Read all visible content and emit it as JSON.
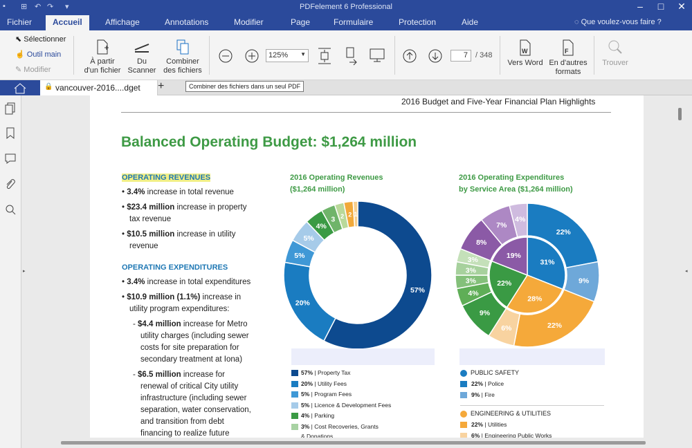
{
  "app": {
    "title": "PDFelement 6 Professional"
  },
  "menu": {
    "items": [
      "Fichier",
      "Accueil",
      "Affichage",
      "Annotations",
      "Modifier",
      "Page",
      "Formulaire",
      "Protection",
      "Aide"
    ],
    "search": "Que voulez-vous faire ?"
  },
  "ribbon": {
    "select": "Sélectionner",
    "hand": "Outil main",
    "edit": "Modifier",
    "from_file": [
      "À partir",
      "d'un fichier"
    ],
    "scanner": [
      "Du",
      "Scanner"
    ],
    "combine": [
      "Combiner",
      "des fichiers"
    ],
    "zoom": "125%",
    "page_current": "7",
    "page_total": "/ 348",
    "to_word": "Vers Word",
    "other_formats": [
      "En d'autres",
      "formats"
    ],
    "find": "Trouver"
  },
  "tabs": {
    "doc": "vancouver-2016....dget",
    "tooltip": "Combiner des fichiers dans un seul PDF"
  },
  "doc": {
    "header": "2016 Budget and Five-Year Financial Plan Highlights",
    "heading": "Balanced Operating Budget: $1,264 million",
    "rev_title": "OPERATING REVENUES",
    "rev_bullets": [
      [
        "3.4%",
        " increase in total revenue"
      ],
      [
        "$23.4 million",
        " increase in property"
      ],
      [
        "",
        "tax revenue"
      ],
      [
        "$10.5 million",
        " increase in utility"
      ],
      [
        "",
        "revenue"
      ]
    ],
    "exp_title": "OPERATING EXPENDITURES",
    "exp_lines": [
      [
        "•",
        "3.4%",
        " increase in total expenditures"
      ],
      [
        "•",
        "$10.9 million (1.1%)",
        " increase in"
      ],
      [
        "",
        "",
        "utility program expenditures:"
      ],
      [
        "-",
        "$4.4 million",
        " increase for Metro"
      ],
      [
        "",
        "",
        "utility charges (including sewer"
      ],
      [
        "",
        "",
        "costs for site preparation for"
      ],
      [
        "",
        "",
        "secondary treatment at Iona)"
      ],
      [
        "-",
        "$6.5 million",
        " increase for"
      ],
      [
        "",
        "",
        "renewal of critical City utility"
      ],
      [
        "",
        "",
        "infrastructure (including sewer"
      ],
      [
        "",
        "",
        "separation, water conservation,"
      ],
      [
        "",
        "",
        "and transition from debt"
      ],
      [
        "",
        "",
        "financing to realize future"
      ]
    ]
  },
  "chart_data": [
    {
      "type": "pie",
      "title": [
        "2016 Operating Revenues",
        "($1,264 million)"
      ],
      "slices": [
        {
          "label": "Property Tax",
          "value": 57,
          "color": "#0d4a8f"
        },
        {
          "label": "Utility Fees",
          "value": 20,
          "color": "#1a7cc1"
        },
        {
          "label": "Program Fees",
          "value": 5,
          "color": "#3f98d6"
        },
        {
          "label": "Licence & Development Fees",
          "value": 5,
          "color": "#a6cbe9"
        },
        {
          "label": "Parking",
          "value": 4,
          "color": "#3a9a44"
        },
        {
          "label": "Cost Recoveries, Grants & Donations",
          "value": 3,
          "color": "#6fb46a"
        },
        {
          "label": "",
          "value": 2,
          "color": "#b9d99a"
        },
        {
          "label": "",
          "value": 2,
          "color": "#f1a93a"
        },
        {
          "label": "",
          "value": 1,
          "color": "#f6cf8f"
        }
      ],
      "slice_labels": [
        "57%",
        "20%",
        "5%",
        "5%",
        "4%",
        "3",
        "2",
        "2",
        "1"
      ],
      "legend": [
        [
          "57%",
          "Property Tax",
          "#0d4a8f"
        ],
        [
          "20%",
          "Utility Fees",
          "#1a7cc1"
        ],
        [
          "5%",
          "Program Fees",
          "#3f98d6"
        ],
        [
          "5%",
          "Licence & Development Fees",
          "#a6cbe9"
        ],
        [
          "4%",
          "Parking",
          "#3a9a44"
        ],
        [
          "3%",
          "Cost Recoveries, Grants",
          "#a8d2a3"
        ],
        [
          "",
          "& Donations",
          ""
        ]
      ]
    },
    {
      "type": "pie",
      "title": [
        "2016 Operating Expenditures",
        "by Service Area ($1,264 million)"
      ],
      "inner": [
        {
          "label": "31%",
          "value": 31,
          "color": "#1a7cc1"
        },
        {
          "label": "28%",
          "value": 28,
          "color": "#f5a93a"
        },
        {
          "label": "22%",
          "value": 22,
          "color": "#3a9a44"
        },
        {
          "label": "19%",
          "value": 19,
          "color": "#8b5aa6"
        }
      ],
      "outer": [
        {
          "label": "22%",
          "value": 22,
          "color": "#1a7cc1"
        },
        {
          "label": "9%",
          "value": 9,
          "color": "#6ea8d9"
        },
        {
          "label": "22%",
          "value": 22,
          "color": "#f5a93a"
        },
        {
          "label": "6%",
          "value": 6,
          "color": "#f8d3a0"
        },
        {
          "label": "9%",
          "value": 9,
          "color": "#3a9a44"
        },
        {
          "label": "4%",
          "value": 4,
          "color": "#5fae57"
        },
        {
          "label": "3%",
          "value": 3,
          "color": "#84c07a"
        },
        {
          "label": "3%",
          "value": 3,
          "color": "#a7d19d"
        },
        {
          "label": "3%",
          "value": 3,
          "color": "#c4e0b9"
        },
        {
          "label": "8%",
          "value": 8,
          "color": "#8b5aa6"
        },
        {
          "label": "7%",
          "value": 7,
          "color": "#ad88c4"
        },
        {
          "label": "4%",
          "value": 4,
          "color": "#cfbbdf"
        }
      ],
      "legend": {
        "group1": "PUBLIC SAFETY",
        "items1": [
          [
            "22%",
            "Police",
            "#1a7cc1"
          ],
          [
            "9%",
            "Fire",
            "#6ea8d9"
          ]
        ],
        "group2": "ENGINEERING & UTILITIES",
        "items2": [
          [
            "22%",
            "Utilities",
            "#f5a93a"
          ],
          [
            "6%",
            "Engineering Public Works",
            "#f8d3a0"
          ]
        ],
        "g1color": "#1a7cc1",
        "g2color": "#f5a93a"
      }
    }
  ]
}
